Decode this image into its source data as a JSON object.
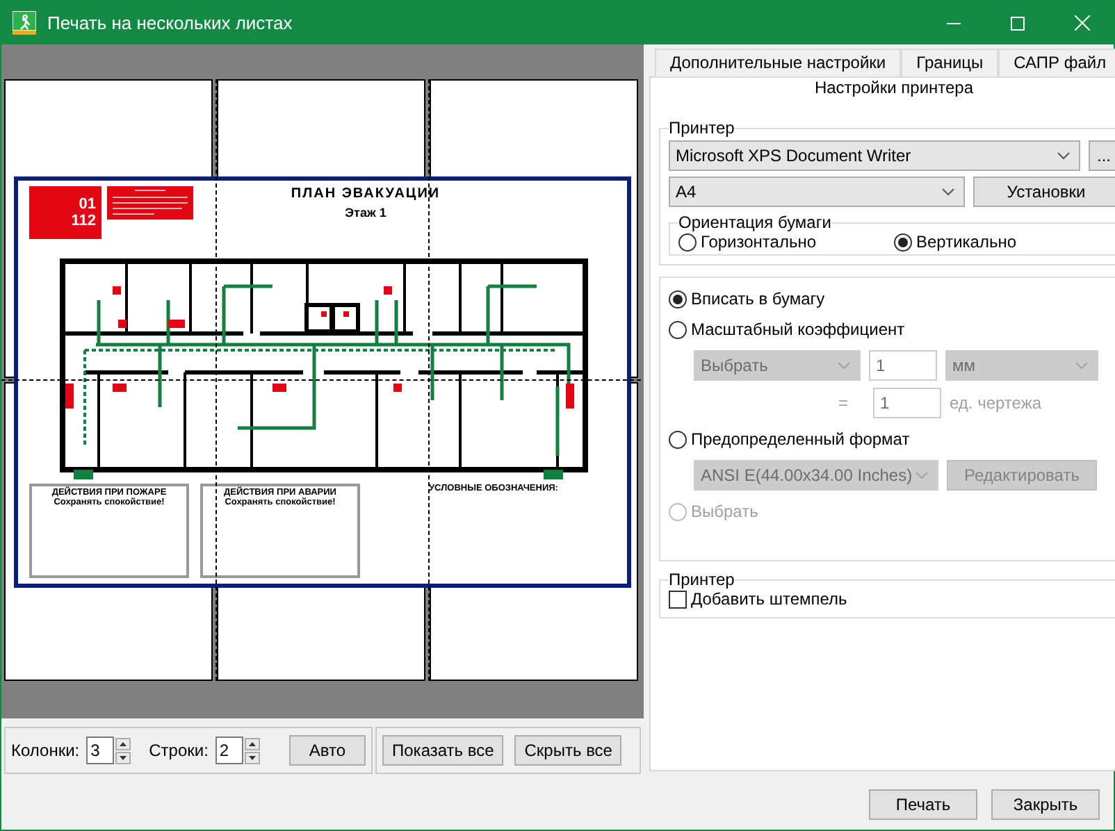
{
  "window": {
    "title": "Печать на нескольких листах"
  },
  "preview": {
    "plan": {
      "red_box_lines": [
        "01",
        "112"
      ],
      "title": "ПЛАН ЭВАКУАЦИИ",
      "floor": "Этаж 1",
      "fire_actions_title": "ДЕЙСТВИЯ ПРИ ПОЖАРЕ",
      "fire_actions_subtitle": "Сохранять спокойствие!",
      "accident_title": "ДЕЙСТВИЯ ПРИ АВАРИИ",
      "accident_subtitle": "Сохранять спокойствие!",
      "legend_title": "УСЛОВНЫЕ ОБОЗНАЧЕНИЯ:"
    }
  },
  "grid_controls": {
    "columns_label": "Колонки:",
    "columns_value": "3",
    "rows_label": "Строки:",
    "rows_value": "2",
    "auto_button": "Авто",
    "show_all_button": "Показать все",
    "hide_all_button": "Скрыть все"
  },
  "tabs": [
    {
      "label": "Дополнительные настройки",
      "selected": false
    },
    {
      "label": "Границы",
      "selected": false
    },
    {
      "label": "САПР файл",
      "selected": false
    },
    {
      "label": "Настройки принтера",
      "selected": true
    }
  ],
  "printer_group": {
    "legend": "Принтер",
    "printer_value": "Microsoft XPS Document Writer",
    "more_button": "...",
    "paper_value": "A4",
    "setup_button": "Установки"
  },
  "orientation": {
    "legend": "Ориентация бумаги",
    "options": [
      {
        "label": "Горизонтально",
        "selected": false
      },
      {
        "label": "Вертикально",
        "selected": true
      }
    ]
  },
  "scale_options": [
    {
      "kind": "fit",
      "label": "Вписать в бумагу",
      "selected": true,
      "disabled": false
    },
    {
      "kind": "factor",
      "label": "Масштабный коэффициент",
      "selected": false,
      "disabled": false
    },
    {
      "kind": "format",
      "label": "Предопределенный формат",
      "selected": false,
      "disabled": false
    },
    {
      "kind": "choose",
      "label": "Выбрать",
      "selected": false,
      "disabled": true
    }
  ],
  "scale_factor": {
    "disabled": true,
    "mode_value": "Выбрать",
    "value": "1",
    "unit": "мм",
    "equals": "=",
    "drawing_value": "1",
    "drawing_unit": "ед. чертежа"
  },
  "predefined": {
    "disabled": true,
    "format": "ANSI E(44.00x34.00 Inches)",
    "edit_button": "Редактировать"
  },
  "stamp_group": {
    "legend": "Принтер",
    "checkbox": {
      "label": "Добавить штемпель",
      "checked": false
    }
  },
  "footer_buttons": [
    "Печать",
    "Закрыть"
  ]
}
